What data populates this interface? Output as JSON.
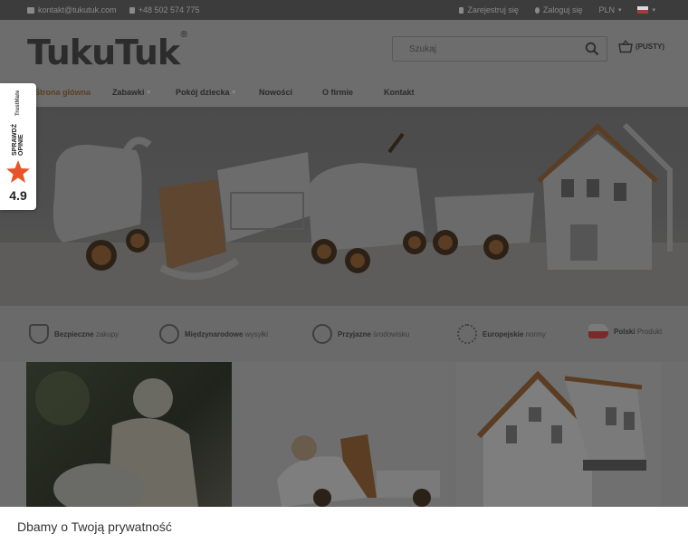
{
  "topbar": {
    "email": "kontakt@tukutuk.com",
    "phone": "+48 502 574 775",
    "register": "Zarejestruj się",
    "login": "Zaloguj się",
    "currency": "PLN"
  },
  "header": {
    "logo": "TukuTuk",
    "logo_mark": "®",
    "search_placeholder": "Szukaj",
    "cart_label": "(PUSTY)"
  },
  "nav": {
    "items": [
      {
        "label": "Strona główna",
        "active": true
      },
      {
        "label": "Zabawki",
        "dropdown": true
      },
      {
        "label": "Pokój dziecka",
        "dropdown": true
      },
      {
        "label": "Nowości"
      },
      {
        "label": "O firmie"
      },
      {
        "label": "Kontakt"
      }
    ]
  },
  "features": [
    {
      "bold": "Bezpieczne",
      "text": "zakupy",
      "icon": "shield-icon"
    },
    {
      "bold": "Międzynarodowe",
      "text": "wysyłki",
      "icon": "globe-plane-icon"
    },
    {
      "bold": "Przyjazne",
      "text": "środowisku",
      "icon": "leaf-icon"
    },
    {
      "bold": "Europejskie",
      "text": "normy",
      "icon": "eu-stars-icon"
    },
    {
      "bold": "Polski",
      "text": "Produkt",
      "icon": "poland-map-icon"
    }
  ],
  "trust_badge": {
    "label": "SPRAWDŹ OPINIE",
    "brand": "TrustMate",
    "score": "4.9"
  },
  "cookie": {
    "title": "Dbamy o Twoją prywatność"
  },
  "colors": {
    "accent": "#5c3f22",
    "star": "#e8542a",
    "topbar": "#3c3c3c"
  }
}
